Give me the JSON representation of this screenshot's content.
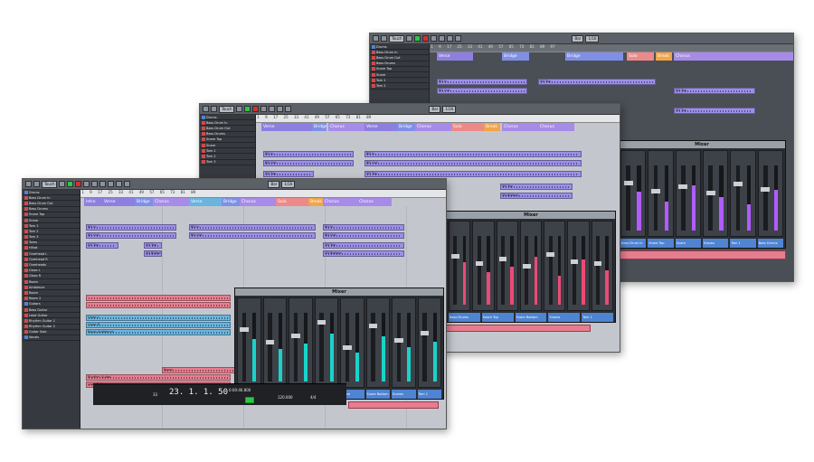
{
  "app": {
    "automation_mode": "Touch",
    "snap_type": "Bar",
    "quantize": "1/16",
    "grid_label": "Bar"
  },
  "colors": {
    "verse": "#8d7fe0",
    "chorus": "#a78be8",
    "bridge": "#7f8fe6",
    "solo": "#ec8a8a",
    "break": "#f2a44a",
    "midi_part": "#9b8fe8",
    "audio_red": "#e67d8f",
    "audio_blue": "#6ab4de",
    "fader_meter": "#19d3c9"
  },
  "markers": [
    {
      "label": "Intro",
      "type": "verse"
    },
    {
      "label": "Verse",
      "type": "verse"
    },
    {
      "label": "Bridge",
      "type": "bridge"
    },
    {
      "label": "Chorus",
      "type": "chorus"
    },
    {
      "label": "Verse",
      "type": "verse"
    },
    {
      "label": "Bridge",
      "type": "bridge"
    },
    {
      "label": "Chorus",
      "type": "chorus"
    },
    {
      "label": "Solo",
      "type": "solo"
    },
    {
      "label": "Break",
      "type": "break"
    },
    {
      "label": "Chorus",
      "type": "chorus"
    },
    {
      "label": "Chorus",
      "type": "chorus"
    }
  ],
  "tracks": [
    {
      "name": "Drums",
      "color": "#4f84d2"
    },
    {
      "name": "Bass Drum In",
      "color": "#d04a4a"
    },
    {
      "name": "Bass Drum Out",
      "color": "#d04a4a"
    },
    {
      "name": "Bass Drums",
      "color": "#d04a4a"
    },
    {
      "name": "Snare Top",
      "color": "#d04a4a"
    },
    {
      "name": "Snare",
      "color": "#d04a4a"
    },
    {
      "name": "Tom 1",
      "color": "#d04a4a"
    },
    {
      "name": "Tom 2",
      "color": "#d04a4a"
    },
    {
      "name": "Tom 3",
      "color": "#d04a4a"
    },
    {
      "name": "Toms",
      "color": "#d04a4a"
    },
    {
      "name": "Hihat",
      "color": "#d04a4a"
    },
    {
      "name": "Overhead L",
      "color": "#d04a4a"
    },
    {
      "name": "Overhead R",
      "color": "#d04a4a"
    },
    {
      "name": "Overheads",
      "color": "#d04a4a"
    },
    {
      "name": "Close L",
      "color": "#d04a4a"
    },
    {
      "name": "Close R",
      "color": "#d04a4a"
    },
    {
      "name": "Room",
      "color": "#d04a4a"
    },
    {
      "name": "Ambience",
      "color": "#d04a4a"
    },
    {
      "name": "Room",
      "color": "#d04a4a"
    },
    {
      "name": "Room 2",
      "color": "#d04a4a"
    },
    {
      "name": "Guitars",
      "color": "#4f84d2"
    },
    {
      "name": "Bass Guitar",
      "color": "#d04a4a"
    },
    {
      "name": "Lead Guitar",
      "color": "#d04a4a"
    },
    {
      "name": "Rhythm Guitar 1",
      "color": "#d04a4a"
    },
    {
      "name": "Rhythm Guitar 2",
      "color": "#d04a4a"
    },
    {
      "name": "Guitar Solo",
      "color": "#d04a4a"
    },
    {
      "name": "Vocals",
      "color": "#4f84d2"
    }
  ],
  "parts": {
    "bd_in": "BD In",
    "bd_out": "BD Out",
    "sn_top": "SN Top",
    "sn_bottom": "SN Bottom",
    "close_l": "Close L",
    "close_r": "Close R",
    "room_ambience": "Room Ambience",
    "rhythm_guitar": "Rhythm Guitar",
    "lead_guitar": "Lead Guitar",
    "room": "Room"
  },
  "mixer": {
    "title": "Mixer",
    "channels": [
      {
        "name": "Bass Drum In",
        "level": 0.62,
        "value": "-3.57"
      },
      {
        "name": "Bass Drum Out",
        "level": 0.48,
        "value": ""
      },
      {
        "name": "Bass Drums",
        "level": 0.55,
        "value": ""
      },
      {
        "name": "Snare Top",
        "level": 0.7,
        "value": ""
      },
      {
        "name": "Snare",
        "level": 0.42,
        "value": ""
      },
      {
        "name": "Snare Bottom",
        "level": 0.66,
        "value": ""
      },
      {
        "name": "Snares",
        "level": 0.5,
        "value": ""
      },
      {
        "name": "Tom 1",
        "level": 0.58,
        "value": "-3.57"
      }
    ],
    "rs0": "RS0"
  },
  "transport": {
    "time": "23. 1. 1. 50",
    "tempo": "120.000",
    "sig": "4/4",
    "lr_time": "0:00:46.800",
    "counter": "33"
  }
}
